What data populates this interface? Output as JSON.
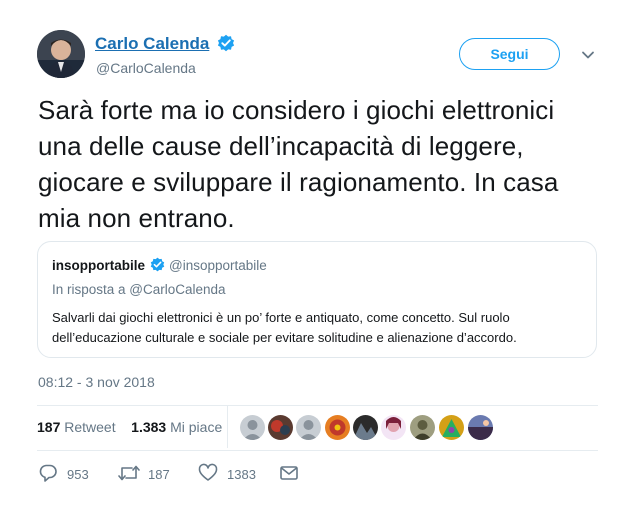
{
  "author": {
    "name": "Carlo Calenda",
    "handle": "@CarloCalenda",
    "follow_label": "Segui"
  },
  "tweet": {
    "text": "Sarà forte ma io considero i giochi elettronici una delle cause dell’incapacità di leggere, giocare e sviluppare il ragionamento. In casa mia non entrano.",
    "timestamp": "08:12 - 3 nov 2018"
  },
  "quote": {
    "name": "insopportabile",
    "handle": "@insopportabile",
    "reply_to": "In risposta a @CarloCalenda",
    "text": "Salvarli dai giochi elettronici è un po’ forte e antiquato, come concetto. Sul ruolo dell’educazione culturale e sociale per evitare solitudine e alienazione d’accordo."
  },
  "stats": {
    "retweets_count": "187",
    "retweets_label": "Retweet",
    "likes_count": "1.383",
    "likes_label": "Mi piace"
  },
  "actions": {
    "replies": "953",
    "retweets": "187",
    "likes": "1383"
  },
  "colors": {
    "link": "#1b6fb2",
    "accent": "#1da1f2",
    "muted": "#657786",
    "border": "#e1e8ed"
  },
  "icons": [
    "verified-badge-icon",
    "chevron-down-icon",
    "reply-icon",
    "retweet-icon",
    "heart-icon",
    "message-icon"
  ]
}
